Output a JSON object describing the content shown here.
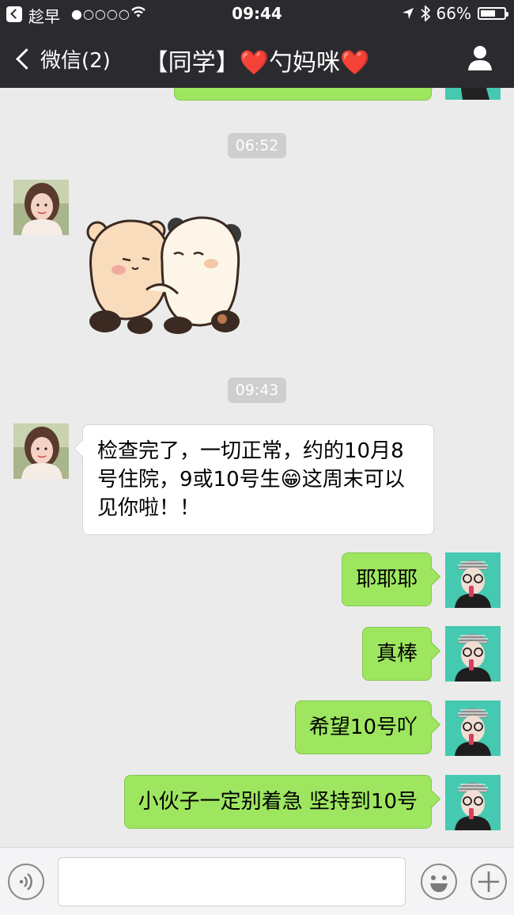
{
  "status_bar": {
    "carrier": "趁早",
    "signal": "●○○○○",
    "time": "09:44",
    "battery_percent": "66%",
    "battery_level": 0.66
  },
  "nav": {
    "back_label": "微信(2)",
    "title": "【同学】❤️勺妈咪❤️"
  },
  "messages": {
    "ts1": "06:52",
    "sticker_desc": "panda-hug-sticker",
    "ts2": "09:43",
    "m1": "检查完了，一切正常，约的10月8号住院，9或10号生😁这周末可以见你啦！！",
    "m2": "耶耶耶",
    "m3": "真棒",
    "m4": "希望10号吖",
    "m5": "小伙子一定别着急 坚持到10号"
  },
  "colors": {
    "nav_bg": "#2b2b2f",
    "chat_bg": "#ebebeb",
    "outgoing_bubble": "#9ee660",
    "incoming_bubble": "#ffffff"
  },
  "icons": [
    "voice-icon",
    "emoji-icon",
    "plus-icon",
    "person-icon",
    "wifi-icon",
    "location-arrow-icon",
    "bluetooth-icon"
  ],
  "input": {
    "value": ""
  }
}
